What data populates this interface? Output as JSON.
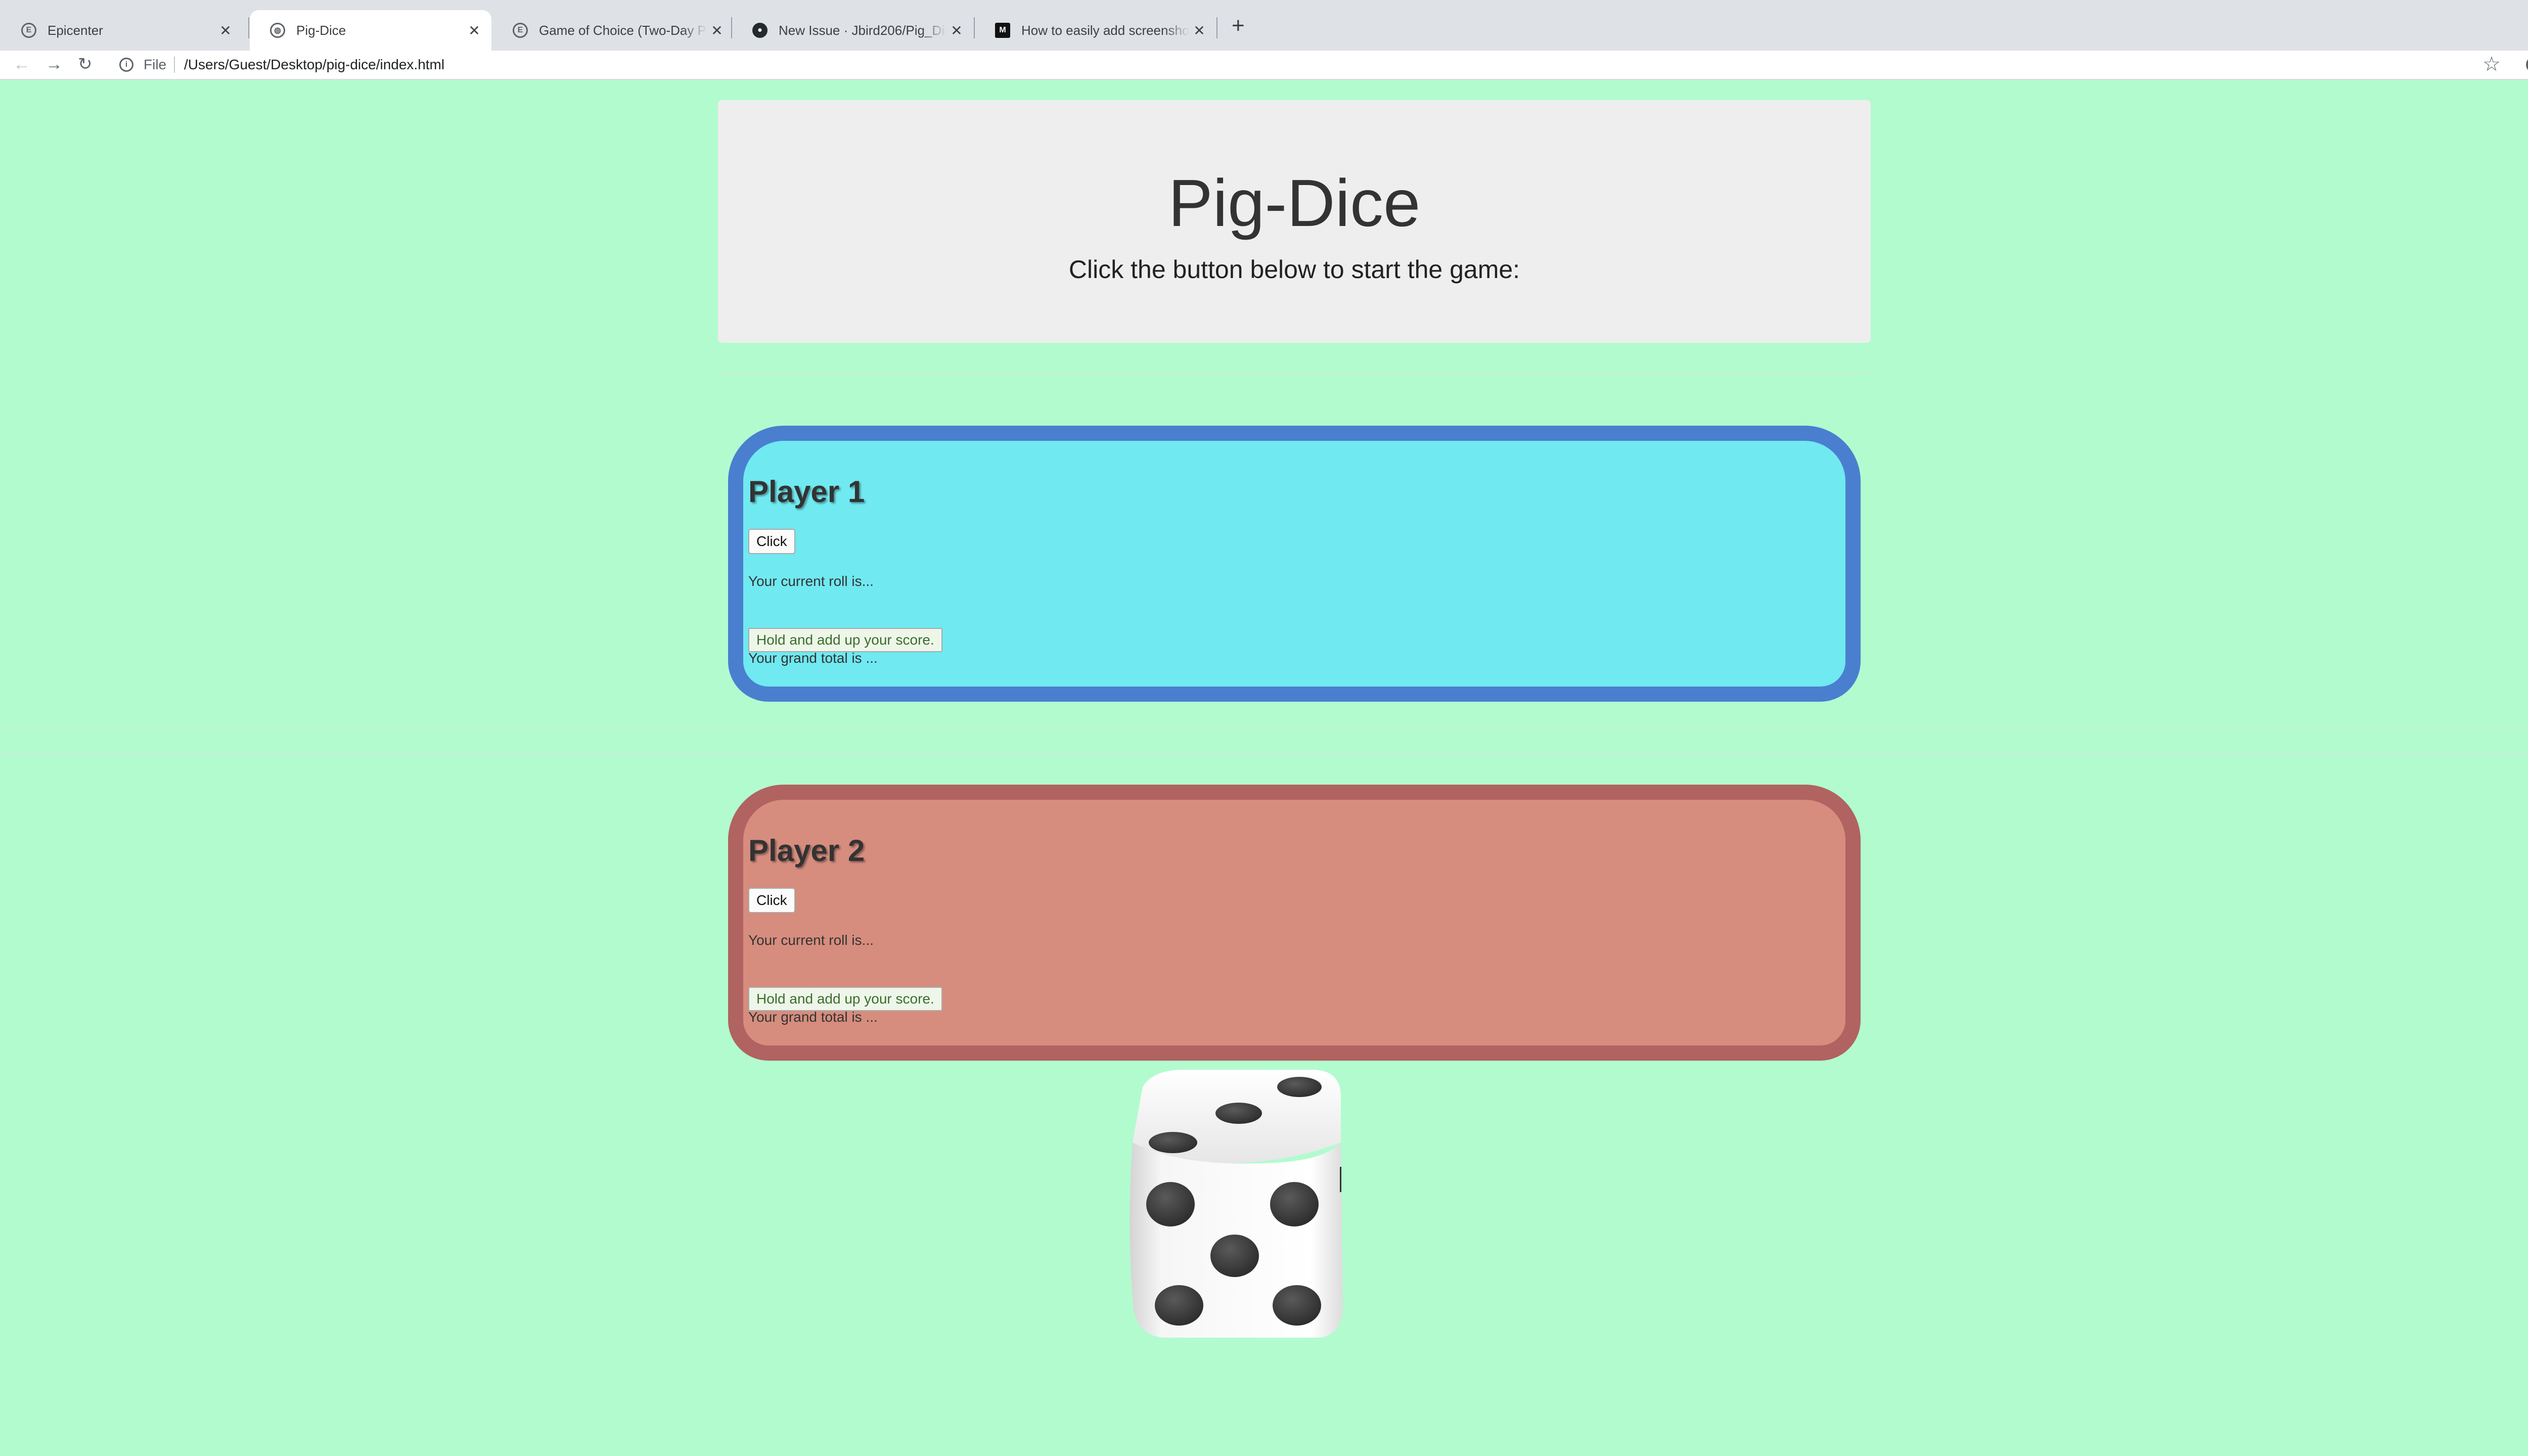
{
  "browser": {
    "tabs": [
      {
        "title": "Epicenter",
        "favicon": "epicenter-icon",
        "active": false
      },
      {
        "title": "Pig-Dice",
        "favicon": "globe-icon",
        "active": true
      },
      {
        "title": "Game of Choice (Two-Day Project)",
        "favicon": "epicenter-icon",
        "active": false
      },
      {
        "title": "New Issue · Jbird206/Pig_Dice",
        "favicon": "github-icon",
        "active": false
      },
      {
        "title": "How to easily add screenshots",
        "favicon": "medium-icon",
        "active": false
      }
    ],
    "new_tab_icon": "plus-icon",
    "address": {
      "scheme_label": "File",
      "url": "/Users/Guest/Desktop/pig-dice/index.html"
    }
  },
  "page": {
    "title": "Pig-Dice",
    "subtitle": "Click the button below to start the game:",
    "players": [
      {
        "name": "Player 1",
        "roll_button": "Click",
        "current_roll": "Your current roll is...",
        "hold_button": "Hold and add up your score.",
        "grand_total": "Your grand total is ...",
        "card_color": "#70e9f1",
        "border_color": "#4a7fcf"
      },
      {
        "name": "Player 2",
        "roll_button": "Click",
        "current_roll": "Your current roll is...",
        "hold_button": "Hold and add up your score.",
        "grand_total": "Your grand total is ...",
        "card_color": "#d68d7e",
        "border_color": "#b06360"
      }
    ],
    "dice": {
      "icon": "dice-icon",
      "front_face": 5,
      "top_face": 3
    },
    "background_color": "#b2fbcf"
  }
}
